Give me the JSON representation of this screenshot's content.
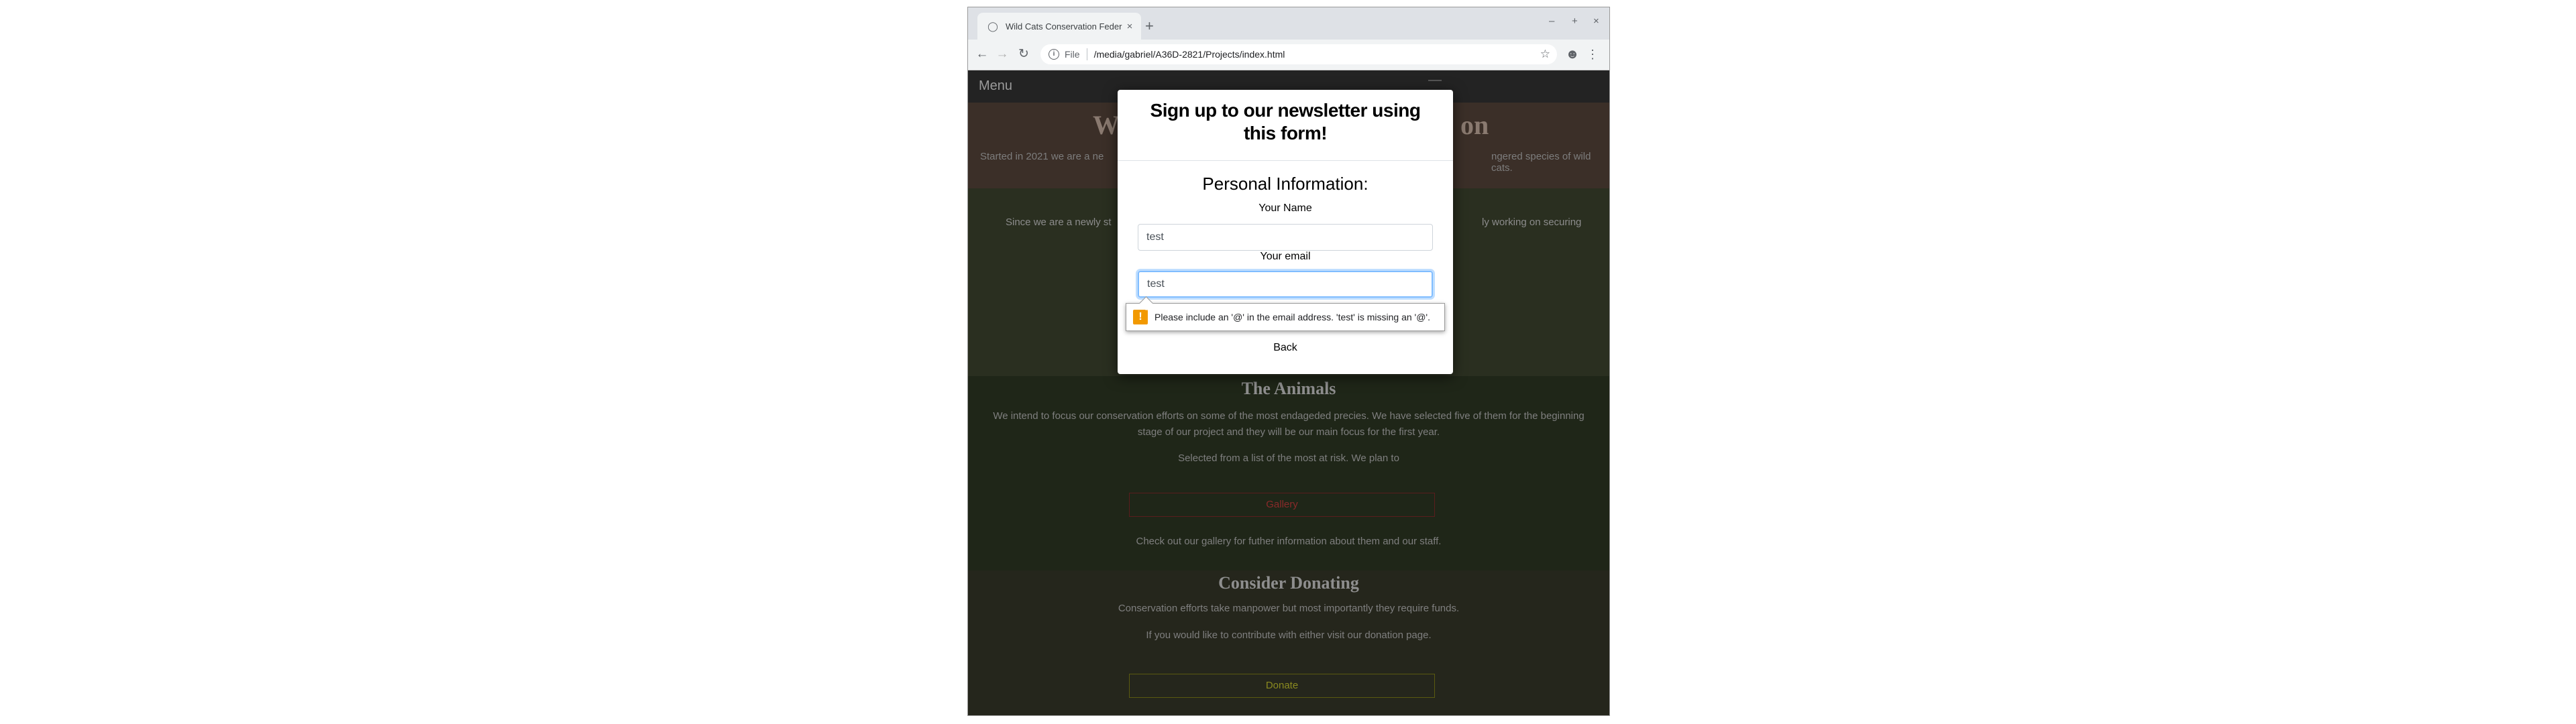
{
  "browser": {
    "tab_title": "Wild Cats Conservation Federa",
    "new_tab": "+",
    "tab_close": "×",
    "window_controls": {
      "minimize": "–",
      "maximize": "+",
      "close": "×"
    },
    "url_scheme_label": "File",
    "url": "/media/gabriel/A36D-2821/Projects/index.html"
  },
  "site": {
    "menu_label": "Menu",
    "hero_title_left": "W",
    "hero_title_right": "on",
    "hero_sub_left": "Started in 2021 we are a ne",
    "hero_sub_right": "ngered species of wild cats.",
    "intro_left": "Since we are a newly st",
    "intro_right": "ly working on securing",
    "animals_title": "The Animals",
    "animals_p1": "We intend to focus our conservation efforts on some of the most endageded precies. We have selected five of them for the beginning stage of our project and they will be our main focus for the first year.",
    "animals_p2": "Selected from a list of the most at risk. We plan to",
    "gallery_button": "Gallery",
    "animals_p3": "Check out our gallery for futher information about them and our staff.",
    "donate_title": "Consider Donating",
    "donate_p1": "Conservation efforts take manpower but most importantly they require funds.",
    "donate_p2": "If you would like to contribute with either visit our donation page.",
    "donate_button": "Donate"
  },
  "modal": {
    "title": "Sign up to our newsletter using this form!",
    "personal_title": "Personal Information:",
    "name_label": "Your Name",
    "name_value": "test",
    "email_label": "Your email",
    "email_value": "test",
    "validation_message": "Please include an '@' in the email address. 'test' is missing an '@'.",
    "back_label": "Back"
  },
  "colors": {
    "email_focus_border": "#80bdff",
    "warning_icon": "#f29900",
    "gallery_button": "#8a2a2a",
    "donate_button": "#8a8a20"
  }
}
